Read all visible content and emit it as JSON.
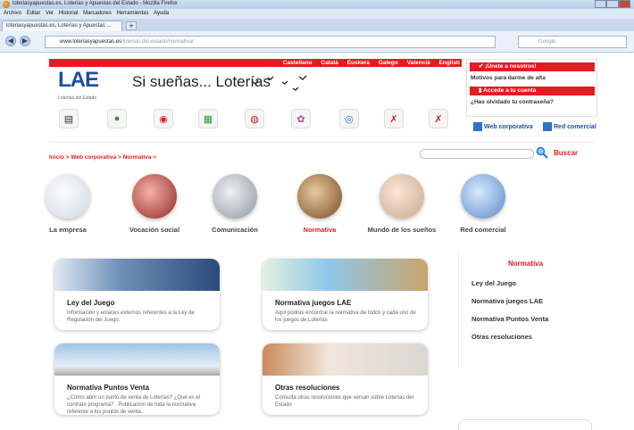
{
  "browser": {
    "window_title": "loteriasyapuestas.es, Loterías y Apuestas del Estado - Mozilla Firefox",
    "menu": [
      "Archivo",
      "Editar",
      "Ver",
      "Historial",
      "Marcadores",
      "Herramientas",
      "Ayuda"
    ],
    "tab_label": "loteriasyapuestas.es, Loterías y Apuestas ...",
    "new_tab": "+",
    "url_domain": "www.loteriasyapuestas.es",
    "url_path": "/loterias-del-estado/normativa/",
    "search_placeholder": "Google"
  },
  "header": {
    "languages": [
      "Castellano",
      "Català",
      "Euskera",
      "Galego",
      "Valencià",
      "English"
    ],
    "logo_text": "LAE",
    "logo_sub": "Loterías del Estado",
    "slogan": "Si sueñas... Loterías"
  },
  "sidebar_account": {
    "join_label": "¡Únete a nosotros!",
    "join_reasons": "Motivos para darme de alta",
    "login_label": "Accede a tu cuenta",
    "forgot_password": "¿Has olvidado tu contraseña?"
  },
  "links": {
    "web_corporativa": "Web corporativa",
    "red_comercial": "Red comercial"
  },
  "breadcrumb": "Inicio > Web corporativa > Normativa >",
  "search": {
    "button": "Buscar"
  },
  "categories": [
    {
      "label": "La empresa"
    },
    {
      "label": "Vocación social"
    },
    {
      "label": "Comunicación"
    },
    {
      "label": "Normativa"
    },
    {
      "label": "Mundo de los sueños"
    },
    {
      "label": "Red comercial"
    }
  ],
  "cards": [
    {
      "title": "Ley del Juego",
      "text": "Información y enlaces externos referentes a la Ley de Regulación del Juego."
    },
    {
      "title": "Normativa juegos LAE",
      "text": "Aquí podrás encontrar la normativa de todos y cada uno de los juegos de Loterías"
    },
    {
      "title": "Normativa Puntos Venta",
      "text": "¿Cómo abrir un punto de venta de Loterías? ¿Qué es el contrato programa? . Publicación de toda la normativa referente a los puntos de venta."
    },
    {
      "title": "Otras resoluciones",
      "text": "Consulta otras resoluciones que versan sobre Loterías del Estado"
    }
  ],
  "normativa_panel": {
    "title": "Normativa",
    "items": [
      "Ley del Juego",
      "Normativa juegos LAE",
      "Normativa Puntos Venta",
      "Otras resoluciones"
    ]
  },
  "colors": {
    "brand_red": "#e21c21",
    "brand_blue": "#1c4f9c"
  },
  "icons": [
    "search-icon",
    "game-icons"
  ]
}
